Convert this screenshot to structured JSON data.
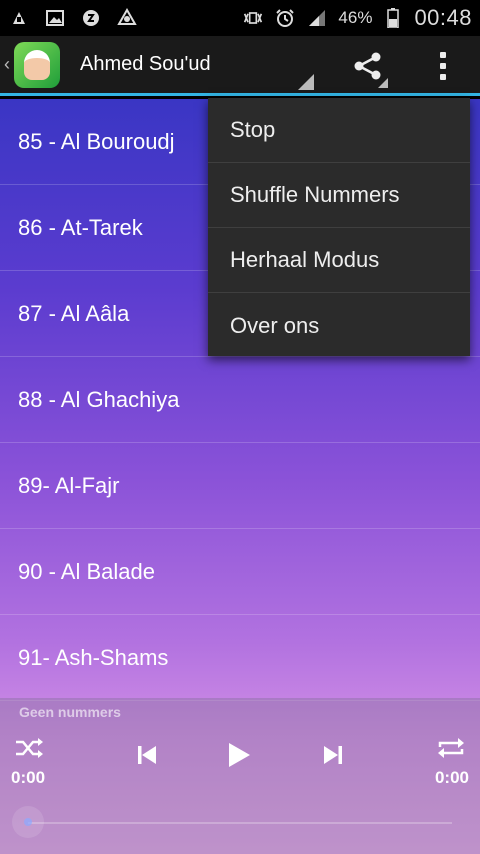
{
  "status_bar": {
    "icons_left": [
      "usb-debug-icon",
      "image-icon",
      "app-notification-icon",
      "sync-triangle-icon"
    ],
    "icons_right": [
      "vibrate-nfc-icon",
      "alarm-icon",
      "signal-icon",
      "battery-icon"
    ],
    "battery_percent": "46%",
    "time": "00:48"
  },
  "action_bar": {
    "title": "Ahmed Sou'ud",
    "icons": [
      "app-logo-icon",
      "share-icon",
      "overflow-menu-icon"
    ]
  },
  "tracks": [
    "85 - Al Bouroudj",
    "86 - At-Tarek",
    "87 - Al Aâla",
    "88 - Al Ghachiya",
    "89- Al-Fajr",
    "90 - Al Balade",
    "91- Ash-Shams"
  ],
  "overflow_menu": {
    "items": [
      "Stop",
      "Shuffle Nummers",
      "Herhaal Modus",
      "Over ons"
    ]
  },
  "player": {
    "now_playing": "Geen nummers",
    "time_elapsed": "0:00",
    "time_total": "0:00",
    "progress": 0
  },
  "colors": {
    "accent": "#33b5e5",
    "action_bar": "#1a1a1a",
    "menu_bg": "#2b2b2b",
    "gradient_top": "#3a36c4",
    "gradient_bottom": "#e4a7ec"
  }
}
